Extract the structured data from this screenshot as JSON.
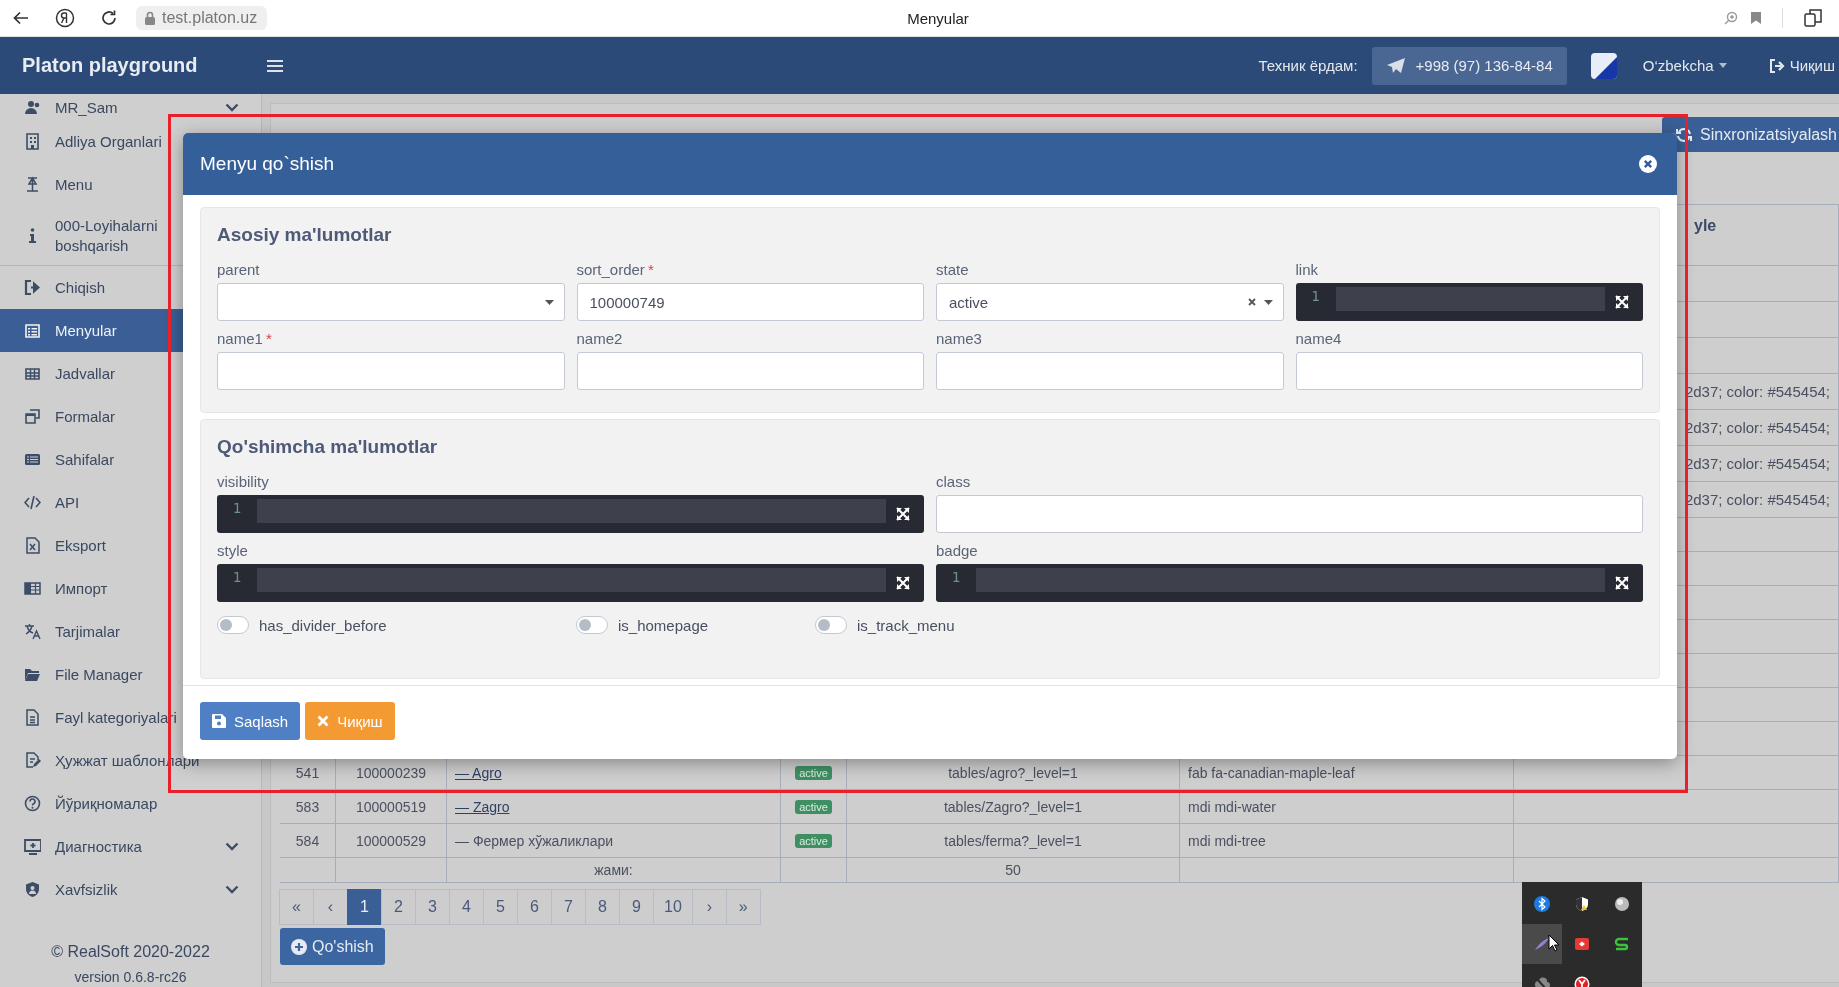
{
  "browser": {
    "url": "test.platon.uz",
    "title": "Menyular"
  },
  "header": {
    "brand": "Platon playground",
    "support_label": "Техник ёрдам:",
    "phone": "+998 (97) 136-84-84",
    "language": "O‘zbekcha",
    "logout": "Чиқиш"
  },
  "sidebar": {
    "items": [
      {
        "label": "MR_Sam",
        "selected": false,
        "kind": "group"
      },
      {
        "label": "Adliya Organlari",
        "selected": false,
        "kind": "link"
      },
      {
        "label": "Menu",
        "selected": false,
        "kind": "link"
      },
      {
        "label": "000-Loyihalarni boshqarish",
        "selected": false,
        "kind": "section_end"
      },
      {
        "label": "Chiqish",
        "selected": false,
        "kind": "link"
      },
      {
        "label": "Menyular",
        "selected": true,
        "kind": "link"
      },
      {
        "label": "Jadvallar",
        "selected": false,
        "kind": "link"
      },
      {
        "label": "Formalar",
        "selected": false,
        "kind": "link"
      },
      {
        "label": "Sahifalar",
        "selected": false,
        "kind": "link"
      },
      {
        "label": "API",
        "selected": false,
        "kind": "link"
      },
      {
        "label": "Eksport",
        "selected": false,
        "kind": "link"
      },
      {
        "label": "Импорт",
        "selected": false,
        "kind": "link"
      },
      {
        "label": "Tarjimalar",
        "selected": false,
        "kind": "link"
      },
      {
        "label": "File Manager",
        "selected": false,
        "kind": "link"
      },
      {
        "label": "Fayl kategoriyalari",
        "selected": false,
        "kind": "link"
      },
      {
        "label": "Ҳужжат шаблонлари",
        "selected": false,
        "kind": "link"
      },
      {
        "label": "Йўриқномалар",
        "selected": false,
        "kind": "link"
      },
      {
        "label": "Диагностика",
        "selected": false,
        "kind": "group"
      },
      {
        "label": "Xavfsizlik",
        "selected": false,
        "kind": "group"
      }
    ],
    "copyright": "© RealSoft 2020-2022",
    "version": "version 0.6.8-rc26"
  },
  "main": {
    "sync_button": "Sinxronizatsiyalash",
    "table": {
      "column_7_header": "yle",
      "rows": [
        {
          "kind": "tail",
          "column_7": "2d37; color: #545454;"
        },
        {
          "kind": "tail",
          "column_7": "2d37; color: #545454;"
        },
        {
          "kind": "tail",
          "column_7": "2d37; color: #545454;"
        },
        {
          "kind": "tail",
          "column_7": "2d37; color: #545454;"
        },
        {
          "kind": "full",
          "column_1": "541",
          "column_2": "100000239",
          "column_3": "— Agro",
          "linked": true,
          "column_4": "active",
          "column_5": "tables/agro?_level=1",
          "column_6": "fab fa-canadian-maple-leaf"
        },
        {
          "kind": "full",
          "column_1": "583",
          "column_2": "100000519",
          "column_3": "— Zagro",
          "linked": true,
          "column_4": "active",
          "column_5": "tables/Zagro?_level=1",
          "column_6": "mdi mdi-water"
        },
        {
          "kind": "full",
          "column_1": "584",
          "column_2": "100000529",
          "column_3": "— Фермер хўжаликлари",
          "linked": false,
          "column_4": "active",
          "column_5": "tables/ferma?_level=1",
          "column_6": "mdi mdi-tree"
        }
      ],
      "footer": {
        "label": "жами:",
        "total": "50"
      }
    },
    "pagination": [
      {
        "label": "«",
        "selected": false
      },
      {
        "label": "‹",
        "selected": false
      },
      {
        "label": "1",
        "selected": true
      },
      {
        "label": "2",
        "selected": false
      },
      {
        "label": "3",
        "selected": false
      },
      {
        "label": "4",
        "selected": false
      },
      {
        "label": "5",
        "selected": false
      },
      {
        "label": "6",
        "selected": false
      },
      {
        "label": "7",
        "selected": false
      },
      {
        "label": "8",
        "selected": false
      },
      {
        "label": "9",
        "selected": false
      },
      {
        "label": "10",
        "selected": false
      },
      {
        "label": "›",
        "selected": false
      },
      {
        "label": "»",
        "selected": false
      }
    ],
    "add_button": "Qo'shish"
  },
  "modal": {
    "title": "Menyu qo`shish",
    "sections": [
      {
        "title": "Asosiy ma'lumotlar",
        "fields": [
          {
            "label": "parent",
            "kind": "select"
          },
          {
            "label": "sort_order",
            "required_mark": "*",
            "kind": "text",
            "value": "100000749"
          },
          {
            "label": "state",
            "kind": "clearable_select",
            "value": "active"
          },
          {
            "label": "link",
            "kind": "code",
            "line_number": "1"
          },
          {
            "label": "name1",
            "required_mark": "*",
            "kind": "text"
          },
          {
            "label": "name2",
            "kind": "text"
          },
          {
            "label": "name3",
            "kind": "text"
          },
          {
            "label": "name4",
            "kind": "text"
          }
        ]
      },
      {
        "title": "Qo'shimcha ma'lumotlar",
        "fields": [
          {
            "label": "visibility",
            "kind": "code",
            "line_number": "1"
          },
          {
            "label": "class",
            "kind": "text"
          },
          {
            "label": "style",
            "kind": "code",
            "line_number": "1"
          },
          {
            "label": "badge",
            "kind": "code",
            "line_number": "1"
          }
        ],
        "toggles": [
          {
            "label": "has_divider_before",
            "on": false
          },
          {
            "label": "is_homepage",
            "on": false
          },
          {
            "label": "is_track_menu",
            "on": false
          }
        ]
      }
    ],
    "buttons": [
      {
        "label": "Saqlash",
        "kind": "save"
      },
      {
        "label": "Чиқиш",
        "kind": "cancel"
      }
    ]
  }
}
